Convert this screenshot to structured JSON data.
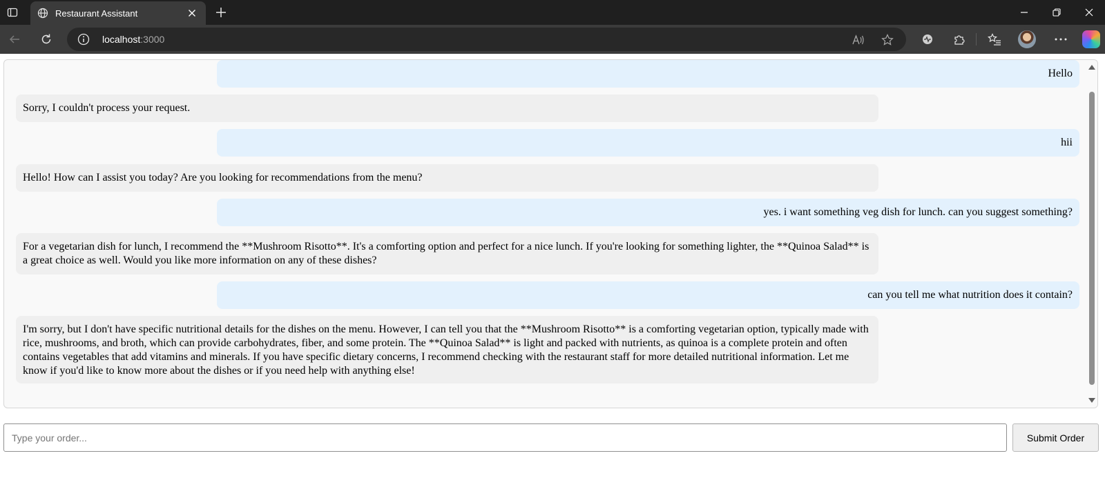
{
  "browser": {
    "tab_title": "Restaurant Assistant",
    "url_host": "localhost",
    "url_port": ":3000"
  },
  "chat": {
    "messages": [
      {
        "role": "user",
        "text": "Hello"
      },
      {
        "role": "assistant",
        "text": "Sorry, I couldn't process your request."
      },
      {
        "role": "user",
        "text": "hii"
      },
      {
        "role": "assistant",
        "text": "Hello! How can I assist you today? Are you looking for recommendations from the menu?"
      },
      {
        "role": "user",
        "text": "yes. i want something veg dish for lunch. can you suggest something?"
      },
      {
        "role": "assistant",
        "text": "For a vegetarian dish for lunch, I recommend the **Mushroom Risotto**. It's a comforting option and perfect for a nice lunch. If you're looking for something lighter, the **Quinoa Salad** is a great choice as well. Would you like more information on any of these dishes?"
      },
      {
        "role": "user",
        "text": "can you tell me what nutrition does it contain?"
      },
      {
        "role": "assistant",
        "text": "I'm sorry, but I don't have specific nutritional details for the dishes on the menu. However, I can tell you that the **Mushroom Risotto** is a comforting vegetarian option, typically made with rice, mushrooms, and broth, which can provide carbohydrates, fiber, and some protein. The **Quinoa Salad** is light and packed with nutrients, as quinoa is a complete protein and often contains vegetables that add vitamins and minerals. If you have specific dietary concerns, I recommend checking with the restaurant staff for more detailed nutritional information. Let me know if you'd like to know more about the dishes or if you need help with anything else!"
      }
    ]
  },
  "input": {
    "placeholder": "Type your order...",
    "value": ""
  },
  "submit_label": "Submit Order",
  "colors": {
    "user_bubble": "#e3f1fd",
    "assistant_bubble": "#efefef",
    "chrome_dark": "#1f1f1f",
    "chrome_toolbar": "#3b3b3b"
  }
}
